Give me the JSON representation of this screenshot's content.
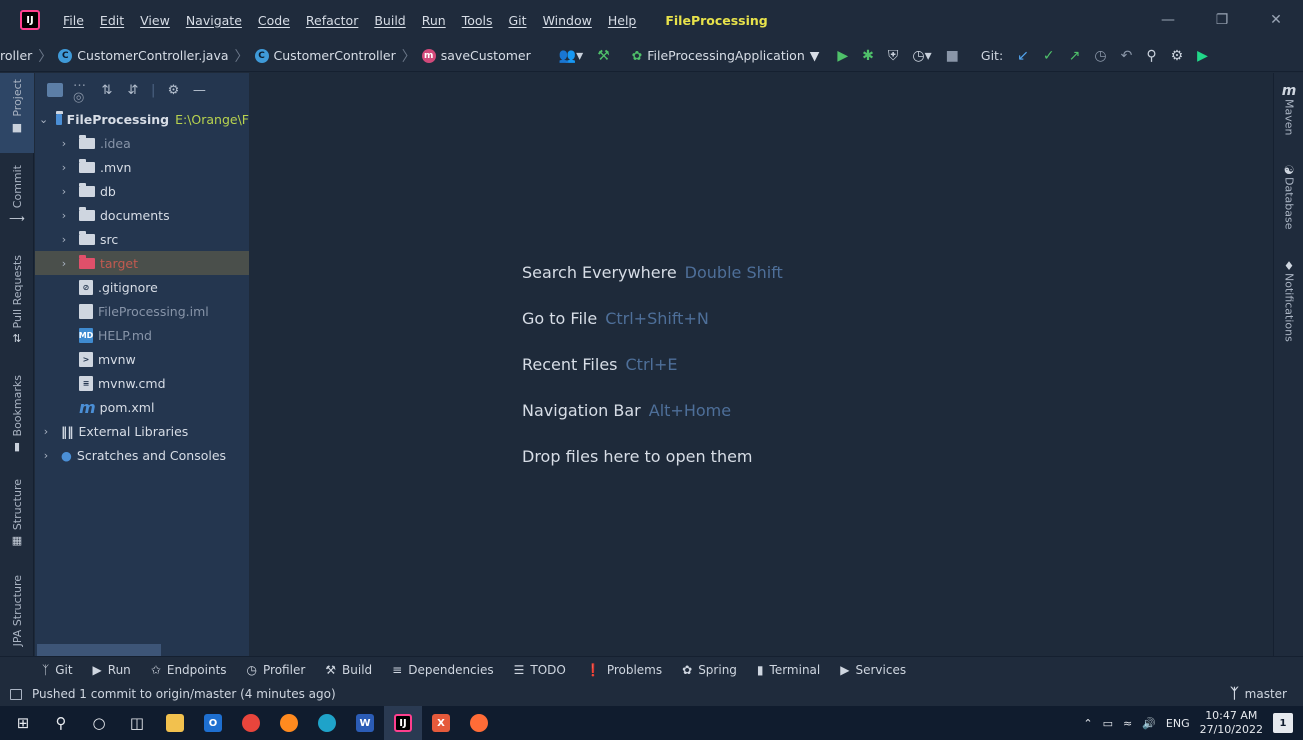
{
  "menubar": {
    "items": [
      "File",
      "Edit",
      "View",
      "Navigate",
      "Code",
      "Refactor",
      "Build",
      "Run",
      "Tools",
      "Git",
      "Window",
      "Help"
    ],
    "project_title": "FileProcessing"
  },
  "breadcrumb": {
    "root": "roller",
    "file": "CustomerController.java",
    "class": "CustomerController",
    "method": "saveCustomer"
  },
  "toolbar": {
    "run_config": "FileProcessingApplication",
    "git_label": "Git:"
  },
  "left_stripe": [
    "Project",
    "Commit",
    "Pull Requests",
    "Bookmarks",
    "Structure",
    "JPA Structure"
  ],
  "right_stripe": [
    "Maven",
    "Database",
    "Notifications"
  ],
  "project_tree": {
    "root_name": "FileProcessing",
    "root_path": "E:\\Orange\\F",
    "items": [
      {
        "label": ".idea"
      },
      {
        "label": ".mvn"
      },
      {
        "label": "db"
      },
      {
        "label": "documents"
      },
      {
        "label": "src"
      },
      {
        "label": "target"
      },
      {
        "label": ".gitignore"
      },
      {
        "label": "FileProcessing.iml"
      },
      {
        "label": "HELP.md"
      },
      {
        "label": "mvnw"
      },
      {
        "label": "mvnw.cmd"
      },
      {
        "label": "pom.xml"
      },
      {
        "label": "External Libraries"
      },
      {
        "label": "Scratches and Consoles"
      }
    ]
  },
  "editor_hints": [
    {
      "action": "Search Everywhere",
      "shortcut": "Double Shift"
    },
    {
      "action": "Go to File",
      "shortcut": "Ctrl+Shift+N"
    },
    {
      "action": "Recent Files",
      "shortcut": "Ctrl+E"
    },
    {
      "action": "Navigation Bar",
      "shortcut": "Alt+Home"
    },
    {
      "action": "Drop files here to open them",
      "shortcut": ""
    }
  ],
  "bottom_tools": [
    "Git",
    "Run",
    "Endpoints",
    "Profiler",
    "Build",
    "Dependencies",
    "TODO",
    "Problems",
    "Spring",
    "Terminal",
    "Services"
  ],
  "status": {
    "message": "Pushed 1 commit to origin/master (4 minutes ago)",
    "branch": "master"
  },
  "taskbar": {
    "language": "ENG",
    "time": "10:47 AM",
    "date": "27/10/2022",
    "notification_count": "1"
  }
}
